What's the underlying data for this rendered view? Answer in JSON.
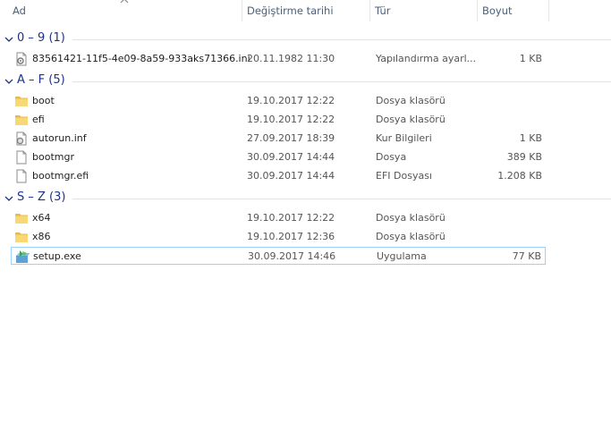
{
  "columns": {
    "name": "Ad",
    "date": "Değiştirme tarihi",
    "type": "Tür",
    "size": "Boyut"
  },
  "groups": [
    {
      "title": "0 – 9 (1)",
      "files": [
        {
          "icon": "config-file-icon",
          "name": "83561421-11f5-4e09-8a59-933aks71366.ini",
          "date": "20.11.1982 11:30",
          "type": "Yapılandırma ayarl...",
          "size": "1 KB"
        }
      ]
    },
    {
      "title": "A – F (5)",
      "files": [
        {
          "icon": "folder-icon",
          "name": "boot",
          "date": "19.10.2017 12:22",
          "type": "Dosya klasörü",
          "size": ""
        },
        {
          "icon": "folder-icon",
          "name": "efi",
          "date": "19.10.2017 12:22",
          "type": "Dosya klasörü",
          "size": ""
        },
        {
          "icon": "setup-info-file-icon",
          "name": "autorun.inf",
          "date": "27.09.2017 18:39",
          "type": "Kur Bilgileri",
          "size": "1 KB"
        },
        {
          "icon": "blank-file-icon",
          "name": "bootmgr",
          "date": "30.09.2017 14:44",
          "type": "Dosya",
          "size": "389 KB"
        },
        {
          "icon": "blank-file-icon",
          "name": "bootmgr.efi",
          "date": "30.09.2017 14:44",
          "type": "EFI Dosyası",
          "size": "1.208 KB"
        }
      ]
    },
    {
      "title": "S – Z (3)",
      "files": [
        {
          "icon": "folder-icon",
          "name": "x64",
          "date": "19.10.2017 12:22",
          "type": "Dosya klasörü",
          "size": ""
        },
        {
          "icon": "folder-icon",
          "name": "x86",
          "date": "19.10.2017 12:36",
          "type": "Dosya klasörü",
          "size": ""
        },
        {
          "icon": "setup-exe-icon",
          "name": "setup.exe",
          "date": "30.09.2017 14:46",
          "type": "Uygulama",
          "size": "77 KB"
        }
      ]
    }
  ],
  "colors": {
    "group_title": "#1e3287",
    "header_text": "#4c607a",
    "selection_border": "#99d1ff",
    "folder": "#f8d775"
  }
}
